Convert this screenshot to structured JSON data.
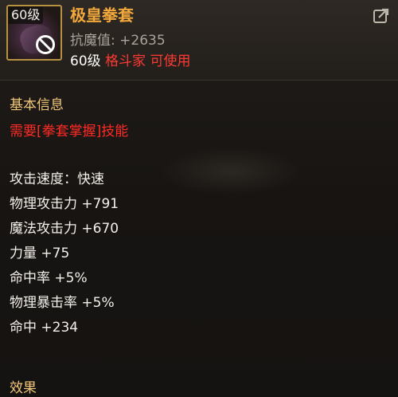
{
  "item": {
    "level_badge": "60级",
    "name": "极皇拳套",
    "resist": "抗魔值: +2635",
    "req_level": "60级",
    "req_class": "格斗家",
    "req_usable": "可使用"
  },
  "sections": {
    "basic_info": "基本信息",
    "skill_req": "需要[拳套掌握]技能",
    "effect": "效果"
  },
  "stats": [
    "攻击速度：快速",
    "物理攻击力 +791",
    "魔法攻击力 +670",
    "力量 +75",
    "命中率 +5%",
    "物理暴击率 +5%",
    "命中 +234"
  ],
  "colors": {
    "name": "#f2a83a",
    "class_text": "#ff3a33",
    "skill_req": "#ff2b24",
    "section_title": "#f2c77a"
  },
  "icons": {
    "item": "gauntlet-icon",
    "status": "no-entry-icon",
    "share": "share-icon"
  }
}
